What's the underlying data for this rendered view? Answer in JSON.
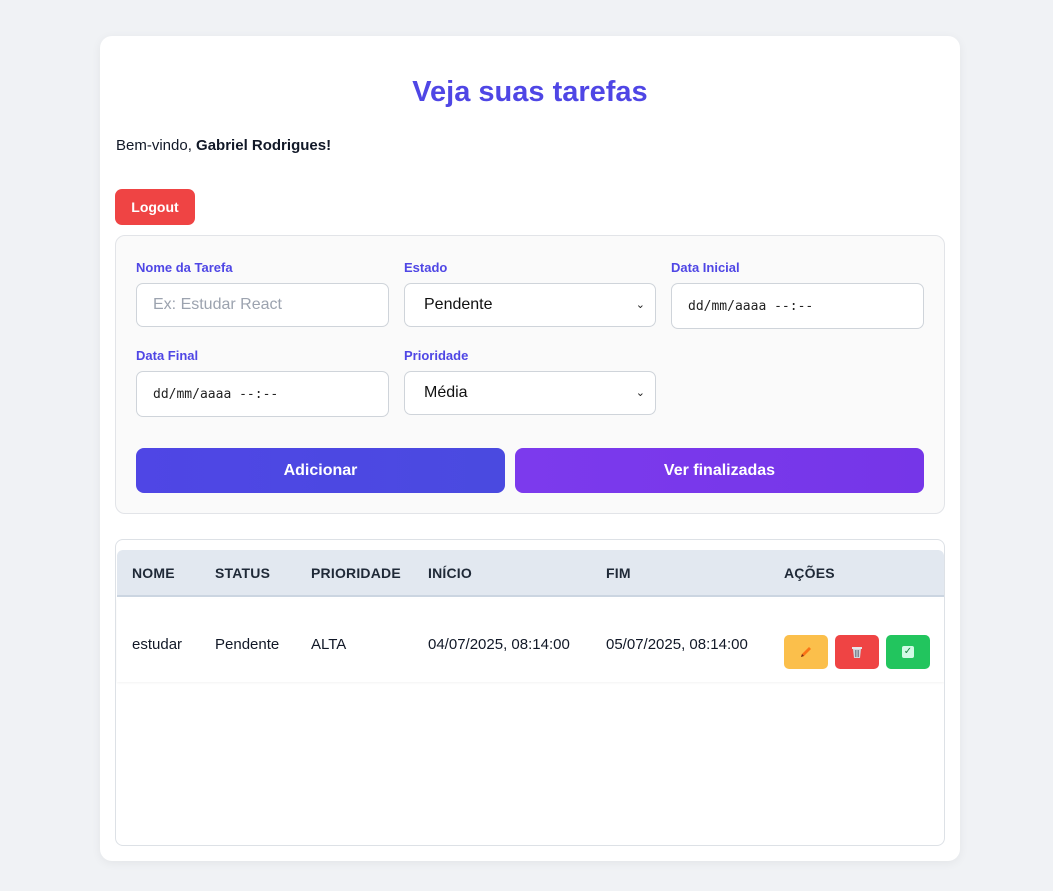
{
  "header": {
    "title": "Veja suas tarefas",
    "welcome_prefix": "Bem-vindo, ",
    "user_name": "Gabriel Rodrigues!"
  },
  "logout_label": "Logout",
  "form": {
    "task_name_label": "Nome da Tarefa",
    "task_name_placeholder": "Ex: Estudar React",
    "state_label": "Estado",
    "state_value": "Pendente",
    "start_label": "Data Inicial",
    "start_value": "dd/mm/aaaa --:--",
    "end_label": "Data Final",
    "end_value": "dd/mm/aaaa --:--",
    "priority_label": "Prioridade",
    "priority_value": "Média",
    "add_label": "Adicionar",
    "finished_label": "Ver finalizadas"
  },
  "table": {
    "headers": [
      "NOME",
      "STATUS",
      "PRIORIDADE",
      "INÍCIO",
      "FIM",
      "AÇÕES"
    ],
    "rows": [
      {
        "nome": "estudar",
        "status": "Pendente",
        "prioridade": "ALTA",
        "inicio": "04/07/2025, 08:14:00",
        "fim": "05/07/2025, 08:14:00"
      }
    ]
  },
  "icons": {
    "edit": "pencil-icon",
    "delete": "trash-icon",
    "complete": "check-icon"
  },
  "colors": {
    "accent": "#4f46e5",
    "purple": "#7c3aed",
    "danger": "#ef4444",
    "warning": "#fbbf4b",
    "success": "#22c55e"
  }
}
